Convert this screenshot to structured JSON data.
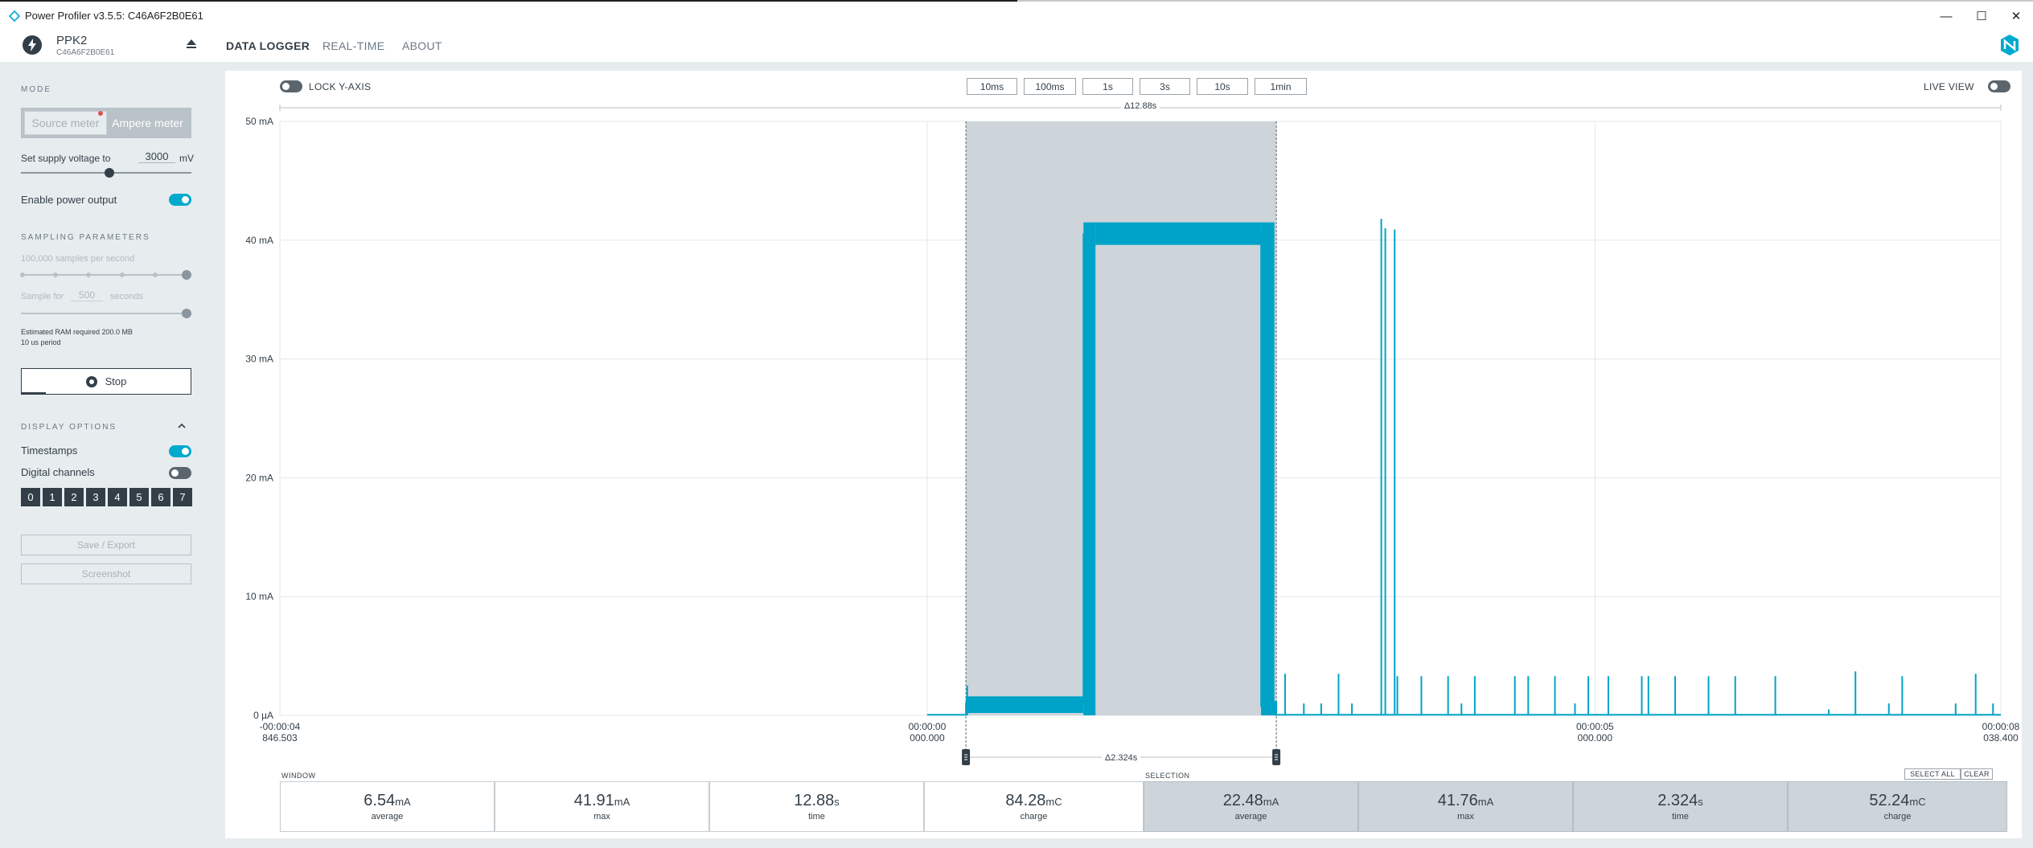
{
  "window": {
    "title": "Power Profiler v3.5.5: C46A6F2B0E61",
    "controls": [
      "minimize",
      "maximize",
      "close"
    ]
  },
  "device": {
    "name": "PPK2",
    "serial": "C46A6F2B0E61"
  },
  "nav": {
    "tabs": [
      {
        "label": "DATA LOGGER",
        "active": true
      },
      {
        "label": "REAL-TIME",
        "active": false
      },
      {
        "label": "ABOUT",
        "active": false
      }
    ]
  },
  "sidebar": {
    "mode": {
      "title": "MODE",
      "options": [
        "Source meter",
        "Ampere meter"
      ],
      "selected": "Ampere meter"
    },
    "supply": {
      "label": "Set supply voltage to",
      "value": "3000",
      "unit": "mV",
      "slider_fraction": 0.55
    },
    "power_output": {
      "label": "Enable power output",
      "on": true
    },
    "sampling": {
      "title": "SAMPLING PARAMETERS",
      "rate_label": "100,000 samples per second",
      "duration_prefix": "Sample for",
      "duration_value": "500",
      "duration_suffix": "seconds",
      "ram": "Estimated RAM required 200.0 MB",
      "period": "10 us period"
    },
    "stop_label": "Stop",
    "display": {
      "title": "DISPLAY OPTIONS",
      "timestamps_label": "Timestamps",
      "timestamps_on": true,
      "digital_label": "Digital channels",
      "digital_on": false,
      "channels": [
        "0",
        "1",
        "2",
        "3",
        "4",
        "5",
        "6",
        "7"
      ]
    },
    "save_label": "Save / Export",
    "screenshot_label": "Screenshot"
  },
  "toolbar": {
    "lock_label": "LOCK Y-AXIS",
    "lock_on": false,
    "live_label": "LIVE VIEW",
    "live_on": false,
    "time_buttons": [
      "10ms",
      "100ms",
      "1s",
      "3s",
      "10s",
      "1min"
    ]
  },
  "chart_data": {
    "type": "line",
    "y_axis": {
      "ticks": [
        "0 µA",
        "10 mA",
        "20 mA",
        "30 mA",
        "40 mA",
        "50 mA"
      ],
      "ylim_mA": [
        0,
        50
      ]
    },
    "x_axis": {
      "ticks": [
        {
          "line1": "-00:00:04",
          "line2": "846.503",
          "t": -4.846503
        },
        {
          "line1": "00:00:00",
          "line2": "000.000",
          "t": 0
        },
        {
          "line1": "00:00:05",
          "line2": "000.000",
          "t": 5
        },
        {
          "line1": "00:00:08",
          "line2": "038.400",
          "t": 8.0384
        }
      ],
      "xlim_s": [
        -4.846503,
        8.0384
      ]
    },
    "window_delta": "Δ12.88s",
    "selection_delta": "Δ2.324s",
    "selection_s": [
      0.29,
      2.614
    ],
    "series": [
      {
        "color": "#00a3c8",
        "segments": [
          {
            "t0": 0.0,
            "t1": 0.29,
            "mA": 0.05
          },
          {
            "t0": 0.29,
            "t1": 0.38,
            "mA": 1.0
          },
          {
            "t0": 0.38,
            "t1": 1.17,
            "mA": 1.0
          },
          {
            "t0": 1.17,
            "t1": 1.26,
            "mA": 40.5
          },
          {
            "t0": 1.26,
            "t1": 2.5,
            "mA": 40.5
          },
          {
            "t0": 2.5,
            "t1": 2.6,
            "mA": 0.8
          },
          {
            "t0": 2.6,
            "t1": 8.0384,
            "mA": 0.05
          }
        ],
        "spikes": [
          {
            "t": 0.3,
            "mA": 2.5
          },
          {
            "t": 1.18,
            "mA": 41.0
          },
          {
            "t": 2.52,
            "mA": 41.0
          },
          {
            "t": 2.68,
            "mA": 3.5
          },
          {
            "t": 2.82,
            "mA": 1.0
          },
          {
            "t": 2.95,
            "mA": 1.0
          },
          {
            "t": 3.08,
            "mA": 3.5
          },
          {
            "t": 3.18,
            "mA": 1.0
          },
          {
            "t": 3.4,
            "mA": 41.8
          },
          {
            "t": 3.43,
            "mA": 41.0
          },
          {
            "t": 3.5,
            "mA": 40.9
          },
          {
            "t": 3.52,
            "mA": 3.3
          },
          {
            "t": 3.7,
            "mA": 3.3
          },
          {
            "t": 3.9,
            "mA": 3.3
          },
          {
            "t": 4.0,
            "mA": 1.0
          },
          {
            "t": 4.1,
            "mA": 3.3
          },
          {
            "t": 4.4,
            "mA": 3.3
          },
          {
            "t": 4.5,
            "mA": 3.3
          },
          {
            "t": 4.7,
            "mA": 3.3
          },
          {
            "t": 4.85,
            "mA": 1.0
          },
          {
            "t": 4.95,
            "mA": 3.3
          },
          {
            "t": 5.1,
            "mA": 3.3
          },
          {
            "t": 5.35,
            "mA": 3.3
          },
          {
            "t": 5.4,
            "mA": 3.3
          },
          {
            "t": 5.6,
            "mA": 3.3
          },
          {
            "t": 5.85,
            "mA": 3.3
          },
          {
            "t": 6.05,
            "mA": 3.3
          },
          {
            "t": 6.35,
            "mA": 3.3
          },
          {
            "t": 6.75,
            "mA": 0.5
          },
          {
            "t": 6.95,
            "mA": 3.7
          },
          {
            "t": 7.2,
            "mA": 1.0
          },
          {
            "t": 7.3,
            "mA": 3.3
          },
          {
            "t": 7.7,
            "mA": 1.0
          },
          {
            "t": 7.85,
            "mA": 3.5
          },
          {
            "t": 7.98,
            "mA": 1.0
          }
        ]
      }
    ]
  },
  "stats": {
    "window_label": "WINDOW",
    "selection_label": "SELECTION",
    "select_all_label": "SELECT ALL",
    "clear_label": "CLEAR",
    "window": [
      {
        "value": "6.54",
        "unit": "mA",
        "label": "average"
      },
      {
        "value": "41.91",
        "unit": "mA",
        "label": "max"
      },
      {
        "value": "12.88",
        "unit": "s",
        "label": "time"
      },
      {
        "value": "84.28",
        "unit": "mC",
        "label": "charge"
      }
    ],
    "selection": [
      {
        "value": "22.48",
        "unit": "mA",
        "label": "average"
      },
      {
        "value": "41.76",
        "unit": "mA",
        "label": "max"
      },
      {
        "value": "2.324",
        "unit": "s",
        "label": "time"
      },
      {
        "value": "52.24",
        "unit": "mC",
        "label": "charge"
      }
    ]
  }
}
